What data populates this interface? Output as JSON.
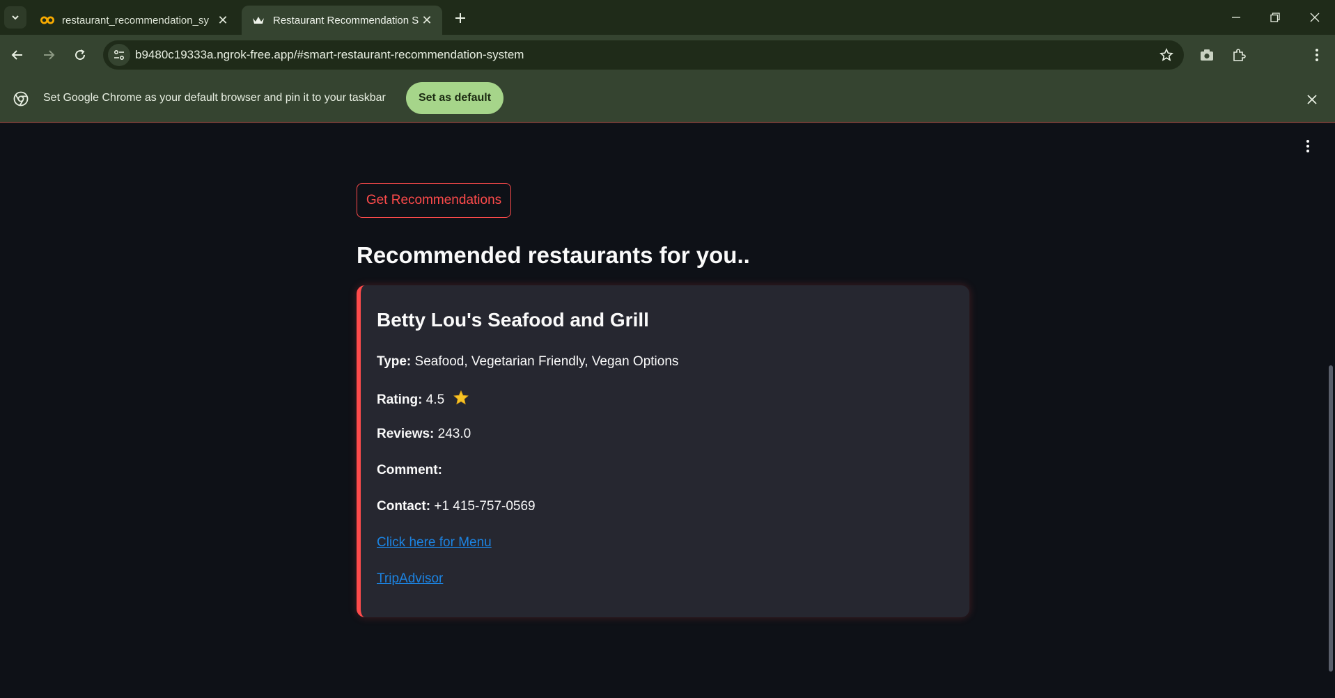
{
  "browser": {
    "tabs": [
      {
        "title": "restaurant_recommendation_sy",
        "favicon": "colab-icon"
      },
      {
        "title": "Restaurant Recommendation Sy",
        "favicon": "streamlit-crown-icon",
        "active": true
      }
    ],
    "url": "b9480c19333a.ngrok-free.app/#smart-restaurant-recommendation-system",
    "infobar": {
      "message": "Set Google Chrome as your default browser and pin it to your taskbar",
      "button_label": "Set as default"
    }
  },
  "app": {
    "button_label": "Get Recommendations",
    "heading": "Recommended restaurants for you..",
    "restaurant": {
      "name": "Betty Lou's Seafood and Grill",
      "type_label": "Type:",
      "type_value": "Seafood, Vegetarian Friendly, Vegan Options",
      "rating_label": "Rating:",
      "rating_value": "4.5",
      "reviews_label": "Reviews:",
      "reviews_value": "243.0",
      "comment_label": "Comment:",
      "comment_value": "",
      "contact_label": "Contact:",
      "contact_value": "+1 415-757-0569",
      "menu_link": "Click here for Menu",
      "tripadvisor_link": "TripAdvisor"
    }
  },
  "colors": {
    "accent": "#ff4b4b",
    "link": "#1c83e1",
    "card_bg": "#262730",
    "page_bg": "#0e1117",
    "chrome_frame": "#354430",
    "infobar_button": "#a6d58a"
  }
}
